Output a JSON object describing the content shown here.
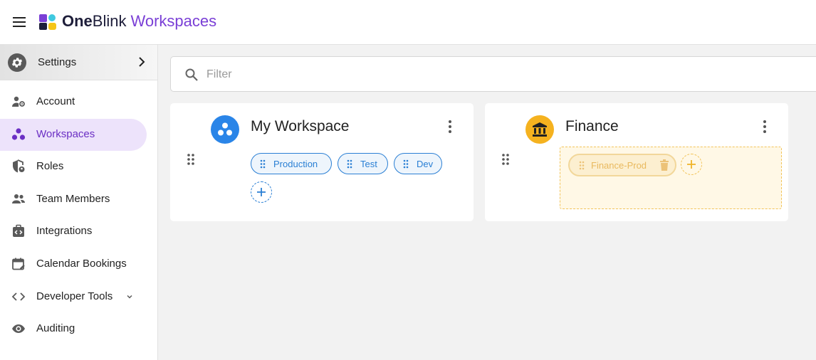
{
  "header": {
    "brand_one": "One",
    "brand_blink": "Blink",
    "brand_product": "Workspaces"
  },
  "sidebar": {
    "settings_label": "Settings",
    "items": [
      {
        "label": "Account",
        "icon": "account-settings-icon"
      },
      {
        "label": "Workspaces",
        "icon": "workspaces-icon",
        "active": true
      },
      {
        "label": "Roles",
        "icon": "roles-shield-icon"
      },
      {
        "label": "Team Members",
        "icon": "team-members-icon"
      },
      {
        "label": "Integrations",
        "icon": "integrations-icon"
      },
      {
        "label": "Calendar Bookings",
        "icon": "calendar-icon"
      },
      {
        "label": "Developer Tools",
        "icon": "code-icon"
      },
      {
        "label": "Auditing",
        "icon": "eye-icon"
      }
    ]
  },
  "filter": {
    "placeholder": "Filter",
    "value": ""
  },
  "workspaces": [
    {
      "name": "My Workspace",
      "avatar_color": "#2a85e8",
      "environments": [
        "Production",
        "Test",
        "Dev"
      ]
    },
    {
      "name": "Finance",
      "avatar_color": "#f5b21f",
      "dragging_environment": "Finance-Prod"
    }
  ],
  "colors": {
    "accent": "#7a3fd6",
    "chip_blue": "#2a7fd4",
    "drop_zone_yellow": "#f2c45a"
  }
}
